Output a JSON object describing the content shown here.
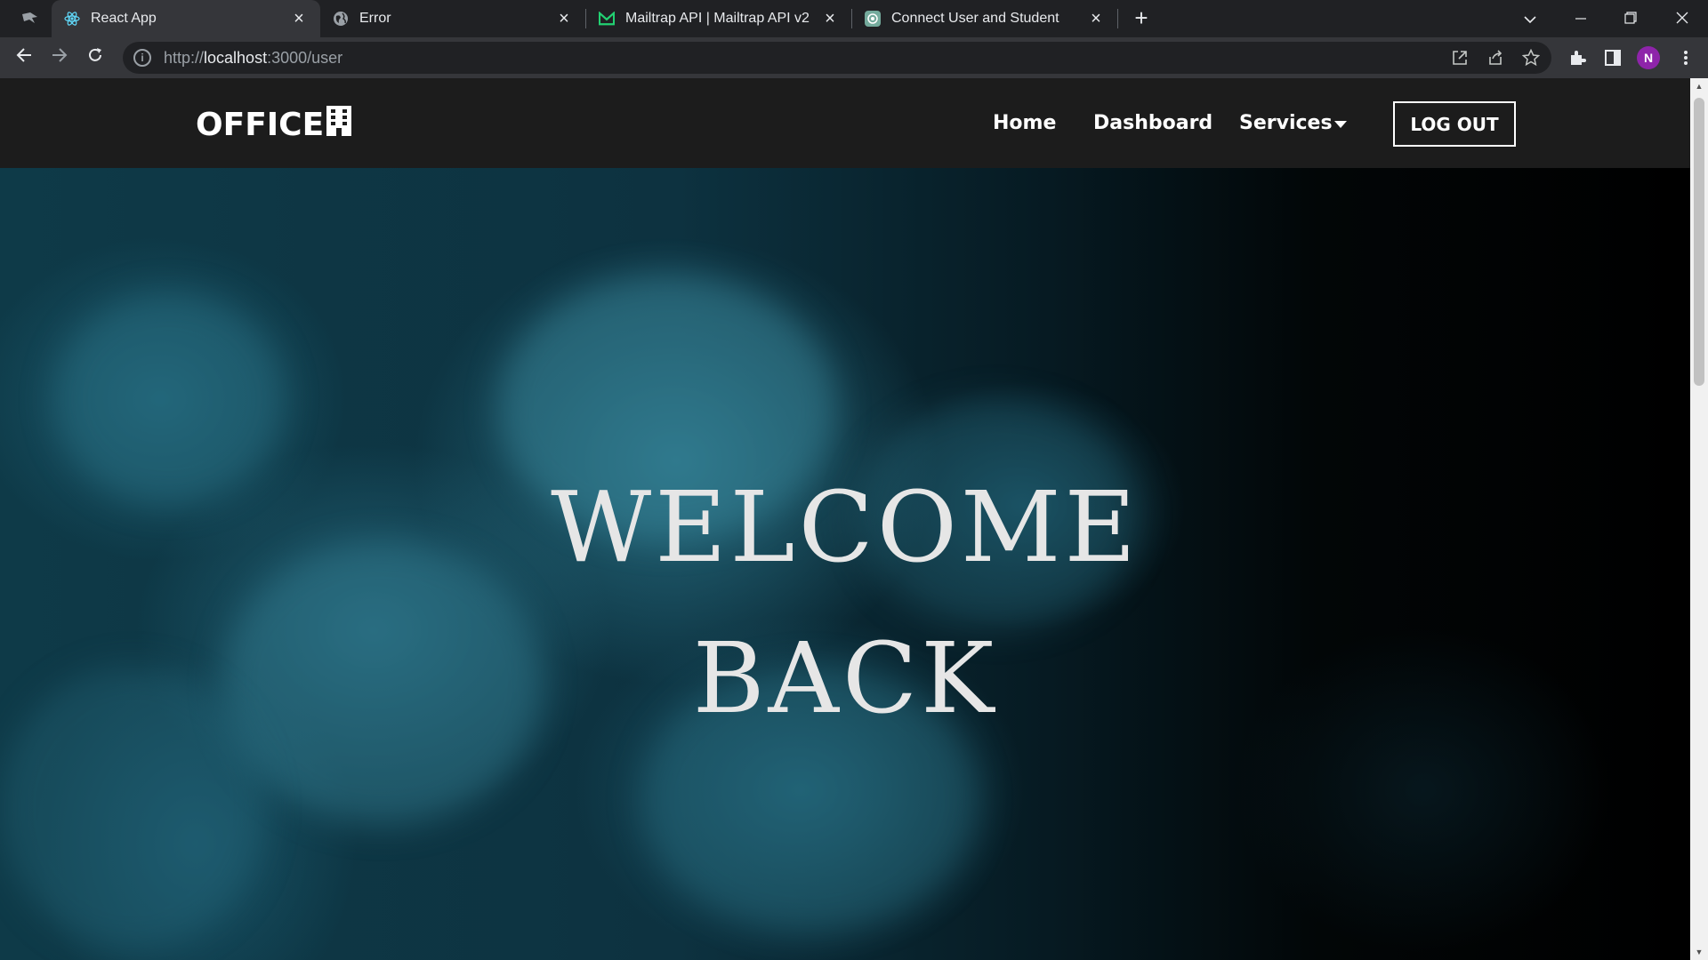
{
  "browser": {
    "tabs": [
      {
        "title": "React App",
        "active": true,
        "icon": "react-icon"
      },
      {
        "title": "Error",
        "active": false,
        "icon": "globe-icon"
      },
      {
        "title": "Mailtrap API | Mailtrap API v2",
        "active": false,
        "icon": "mailtrap-icon"
      },
      {
        "title": "Connect User and Student",
        "active": false,
        "icon": "openai-icon"
      }
    ],
    "url_scheme": "http://",
    "url_host": "localhost",
    "url_rest": ":3000/user",
    "profile_initial": "N"
  },
  "site": {
    "logo": "OFFICE",
    "nav": {
      "home": "Home",
      "dashboard": "Dashboard",
      "services": "Services"
    },
    "logout": "LOG OUT",
    "hero": {
      "line1": "WELCOME",
      "line2": "BACK"
    }
  },
  "colors": {
    "navbar_bg": "#1c1c1c",
    "hero_teal": "#2a6e82",
    "avatar": "#8e24aa"
  }
}
